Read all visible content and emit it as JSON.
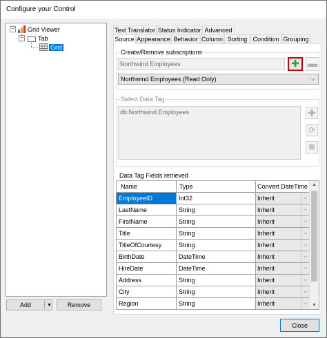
{
  "window": {
    "title": "Configure your Control"
  },
  "tree": {
    "root": "Grid Viewer",
    "child": "Tab",
    "leaf": "Grid"
  },
  "left_buttons": {
    "add": "Add",
    "remove": "Remove"
  },
  "tabs_top": [
    "Text Translator",
    "Status Indicator",
    "Advanced"
  ],
  "tabs_bottom": [
    "Source",
    "Appearance",
    "Behavior",
    "Column",
    "Sorting",
    "Condition",
    "Grouping"
  ],
  "active_tab": "Source",
  "subscriptions": {
    "title": "Create/Remove subscriptions",
    "input_value": "Northwind Employees",
    "combo_value": "Northwind Employees (Read Only)"
  },
  "data_tag": {
    "title": "Select Data Tag",
    "value": "db:Northwind.Employees"
  },
  "fields": {
    "title": "Data Tag Fields retrieved",
    "columns": [
      "Name",
      "Type",
      "Convert DateTime"
    ],
    "rows": [
      {
        "name": "EmployeeID",
        "type": "Int32",
        "convert": "Inherit"
      },
      {
        "name": "LastName",
        "type": "String",
        "convert": "Inherit"
      },
      {
        "name": "FirstName",
        "type": "String",
        "convert": "Inherit"
      },
      {
        "name": "Title",
        "type": "String",
        "convert": "Inherit"
      },
      {
        "name": "TitleOfCourtesy",
        "type": "String",
        "convert": "Inherit"
      },
      {
        "name": "BirthDate",
        "type": "DateTime",
        "convert": "Inherit"
      },
      {
        "name": "HireDate",
        "type": "DateTime",
        "convert": "Inherit"
      },
      {
        "name": "Address",
        "type": "String",
        "convert": "Inherit"
      },
      {
        "name": "City",
        "type": "String",
        "convert": "Inherit"
      },
      {
        "name": "Region",
        "type": "String",
        "convert": "Inherit"
      }
    ]
  },
  "close_label": "Close",
  "colors": {
    "accent": "#0078d7",
    "add_highlight": "#d00000",
    "plus_green": "#2ea043"
  }
}
